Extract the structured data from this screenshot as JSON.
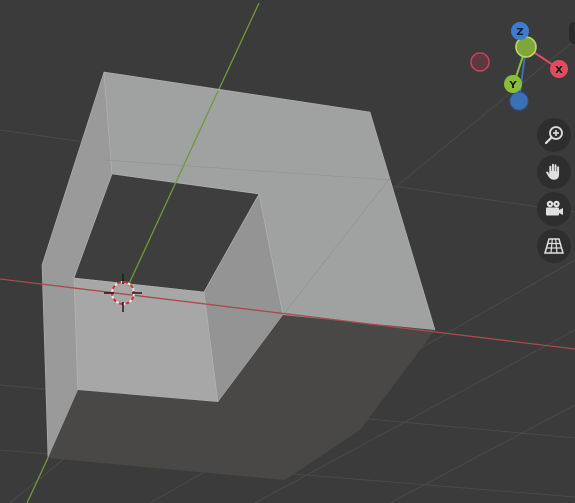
{
  "viewport": {
    "background": "#3b3b3b"
  },
  "gizmo": {
    "x_label": "X",
    "y_label": "Y",
    "z_label": "Z",
    "x_color": "#e04b5e",
    "y_color": "#8bbd3a",
    "z_color": "#3c7dd4",
    "neg_x_color": "#c64256",
    "neg_y_color": "#7fa63a",
    "neg_z_color": "#3a70b8"
  },
  "navigation": {
    "buttons": [
      {
        "name": "zoom-button",
        "icon": "zoom-icon"
      },
      {
        "name": "pan-button",
        "icon": "hand-icon"
      },
      {
        "name": "camera-view-button",
        "icon": "camera-icon"
      },
      {
        "name": "perspective-toggle-button",
        "icon": "grid-icon"
      }
    ]
  },
  "scene": {
    "object": "cube-with-cutout",
    "cursor": "3d-cursor"
  }
}
